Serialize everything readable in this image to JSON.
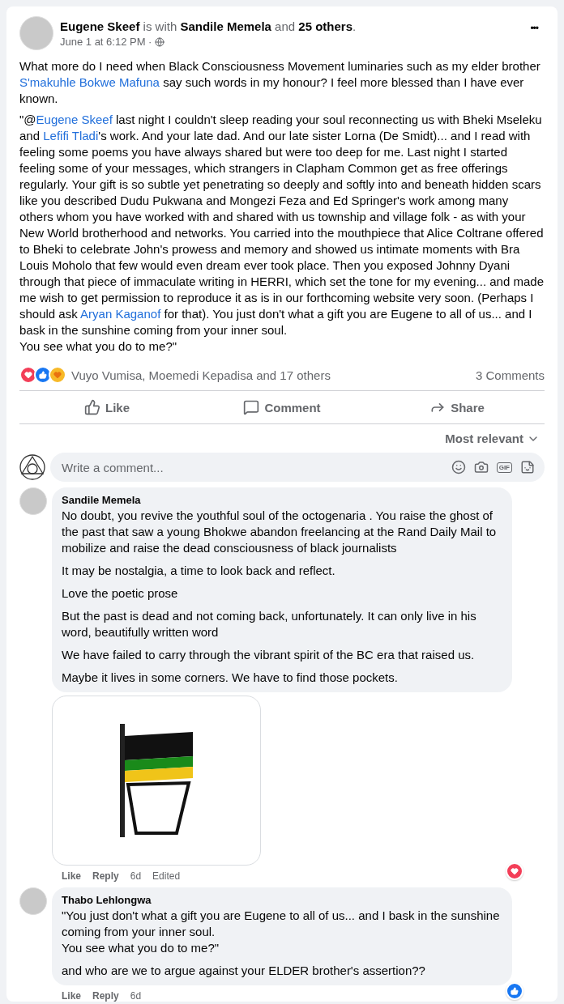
{
  "post": {
    "header": "**Eugene Skeef** is with **Sandile Memela** and **25 others**.",
    "time": "June 1 at 6:12 PM ·",
    "menu": "•••",
    "paragraphs": [
      [
        {
          "kind": "text",
          "text": "What more do I need when Black Consciousness Movement luminaries such as my elder brother "
        },
        {
          "kind": "link",
          "text": "S'makuhle Bokwe Mafuna"
        },
        {
          "kind": "text",
          "text": " say such words in my honour? I feel more blessed than I have ever known."
        }
      ],
      [
        {
          "kind": "text",
          "text": "\"@"
        },
        {
          "kind": "link",
          "text": "Eugene Skeef"
        },
        {
          "kind": "text",
          "text": " last night I couldn't sleep reading your soul reconnecting us with Bheki Mseleku and "
        },
        {
          "kind": "link",
          "text": "Lefifi Tladi"
        },
        {
          "kind": "text",
          "text": "'s work. And your late dad. And our late sister Lorna (De Smidt)... and I read with feeling some poems you have always shared but were too deep for me. Last night I started feeling some of your messages, which strangers in Clapham Common get as free offerings regularly. Your gift is so subtle yet penetrating so deeply and softly into and beneath hidden scars like you described Dudu Pukwana and Mongezi Feza and Ed Springer's work among many others whom you have worked with and shared with us township and village folk - as with your New World brotherhood and networks. You carried into the mouthpiece that Alice Coltrane offered to Bheki to celebrate John's prowess and memory and showed us intimate moments with Bra Louis Moholo that few would even dream ever took place. Then you exposed Johnny Dyani through that piece of immaculate writing in HERRI, which set the tone for my evening... and made me wish to get permission to reproduce it as is in our forthcoming website very soon. (Perhaps I should ask "
        },
        {
          "kind": "link",
          "text": "Aryan Kaganof"
        },
        {
          "kind": "text",
          "text": " for that). You just don't what a gift you are Eugene to all of us... and I bask in the sunshine coming from your inner soul.\nYou see what you do to me?\""
        }
      ]
    ]
  },
  "reactions": {
    "icons": [
      {
        "kind": "heart"
      },
      {
        "kind": "like"
      },
      {
        "kind": "care"
      }
    ],
    "summary": "Vuyo Vumisa, Moemedi Kepadisa and 17 others",
    "comments": "3 Comments"
  },
  "actions": [
    {
      "kind": "like",
      "label": "Like"
    },
    {
      "kind": "comment",
      "label": "Comment"
    },
    {
      "kind": "share",
      "label": "Share"
    }
  ],
  "sort": "Most relevant",
  "composer": {
    "placeholder": "Write a comment...",
    "gif": "GIF"
  },
  "comments": [
    {
      "author": "Sandile Memela",
      "paragraphs": [
        "No doubt, you revive the youthful soul of the octogenaria . You raise the ghost of the past that saw a young Bhokwe abandon freelancing at the Rand Daily Mail to mobilize and raise the dead consciousness of black journalists",
        "It may be nostalgia, a time to look back and reflect.",
        "Love the poetic prose",
        "But the past is dead and not coming back, unfortunately. It can only live in his word, beautifully written word",
        "We have failed to carry through the vibrant spirit of the BC era that raised us.",
        "Maybe it lives in some corners. We have to find those pockets."
      ],
      "attachment": {
        "kind": "image"
      },
      "like": "Like",
      "reply": "Reply",
      "time": "6d",
      "edited": "Edited",
      "reaction": {
        "kind": "heart"
      }
    },
    {
      "author": "Thabo Lehlongwa",
      "paragraphs": [
        "\"You just don't what a gift you are Eugene to all of us... and I bask in the sunshine coming from your inner soul.\nYou see what you do to me?\"",
        "and who are we to argue against your ELDER brother's assertion??"
      ],
      "like": "Like",
      "reply": "Reply",
      "time": "6d",
      "reaction": {
        "kind": "like"
      }
    }
  ]
}
